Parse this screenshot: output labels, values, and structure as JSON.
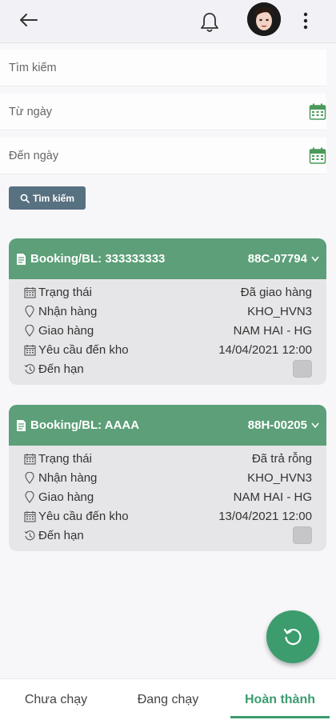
{
  "header": {
    "back_icon": "arrow-left-icon",
    "bell_icon": "bell-icon",
    "more_icon": "more-vertical-icon"
  },
  "search": {
    "keyword_placeholder": "Tìm kiếm",
    "from_date_placeholder": "Từ ngày",
    "to_date_placeholder": "Đến ngày",
    "button_label": "Tìm kiếm"
  },
  "labels": {
    "status": "Trạng thái",
    "pickup": "Nhận hàng",
    "delivery": "Giao hàng",
    "required_arrival": "Yêu cầu đến kho",
    "due": "Đến hạn"
  },
  "cards": [
    {
      "booking": "Booking/BL: 333333333",
      "plate": "88C-07794",
      "status": "Đã giao hàng",
      "pickup": "KHO_HVN3",
      "delivery": "NAM HAI - HG",
      "required_arrival": "14/04/2021 12:00"
    },
    {
      "booking": "Booking/BL: AAAA",
      "plate": "88H-00205",
      "status": "Đã trả rỗng",
      "pickup": "KHO_HVN3",
      "delivery": "NAM HAI - HG",
      "required_arrival": "13/04/2021 12:00"
    }
  ],
  "tabs": [
    "Chưa chạy",
    "Đang chạy",
    "Hoàn thành"
  ],
  "active_tab": 2,
  "colors": {
    "accent_green": "#3c9c6e",
    "card_header": "#5c9f78",
    "search_button": "#587181"
  }
}
